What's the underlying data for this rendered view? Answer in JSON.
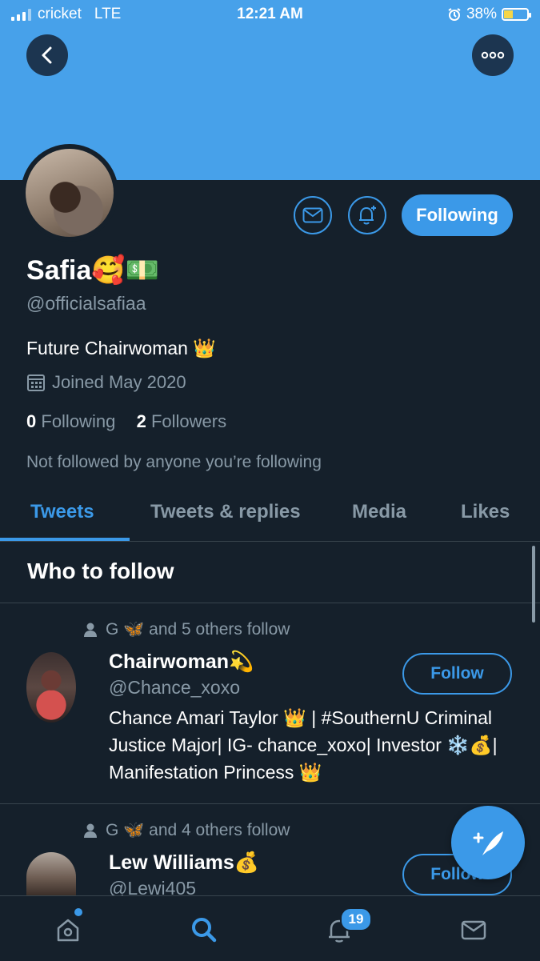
{
  "status_bar": {
    "carrier": "cricket",
    "network": "LTE",
    "time": "12:21 AM",
    "battery": "38%"
  },
  "profile": {
    "name": "Safia🥰💵",
    "handle": "@officialsafiaa",
    "bio": "Future Chairwoman 👑",
    "joined": "Joined May 2020",
    "following_count": "0",
    "following_label": "Following",
    "followers_count": "2",
    "followers_label": "Followers",
    "not_followed": "Not followed by anyone you’re following",
    "following_button": "Following"
  },
  "tabs": [
    "Tweets",
    "Tweets & replies",
    "Media",
    "Likes"
  ],
  "who_to_follow": {
    "title": "Who to follow",
    "users": [
      {
        "social_context": "G 🦋  and 5 others follow",
        "name": "Chairwoman💫",
        "handle": "@Chance_xoxo",
        "bio": "Chance Amari Taylor 👑 | #SouthernU Criminal Justice Major| IG- chance_xoxo| Investor ❄️💰| Manifestation Princess 👑",
        "button": "Follow"
      },
      {
        "social_context": "G 🦋  and 4 others follow",
        "name": "Lew Williams💰",
        "handle": "@Lewi405",
        "button": "Follow"
      }
    ]
  },
  "bottom_nav": {
    "notifications_badge": "19"
  },
  "colors": {
    "background": "#15202b",
    "accent": "#3b99e8",
    "banner": "#47a1ea",
    "muted": "#8899a6"
  }
}
